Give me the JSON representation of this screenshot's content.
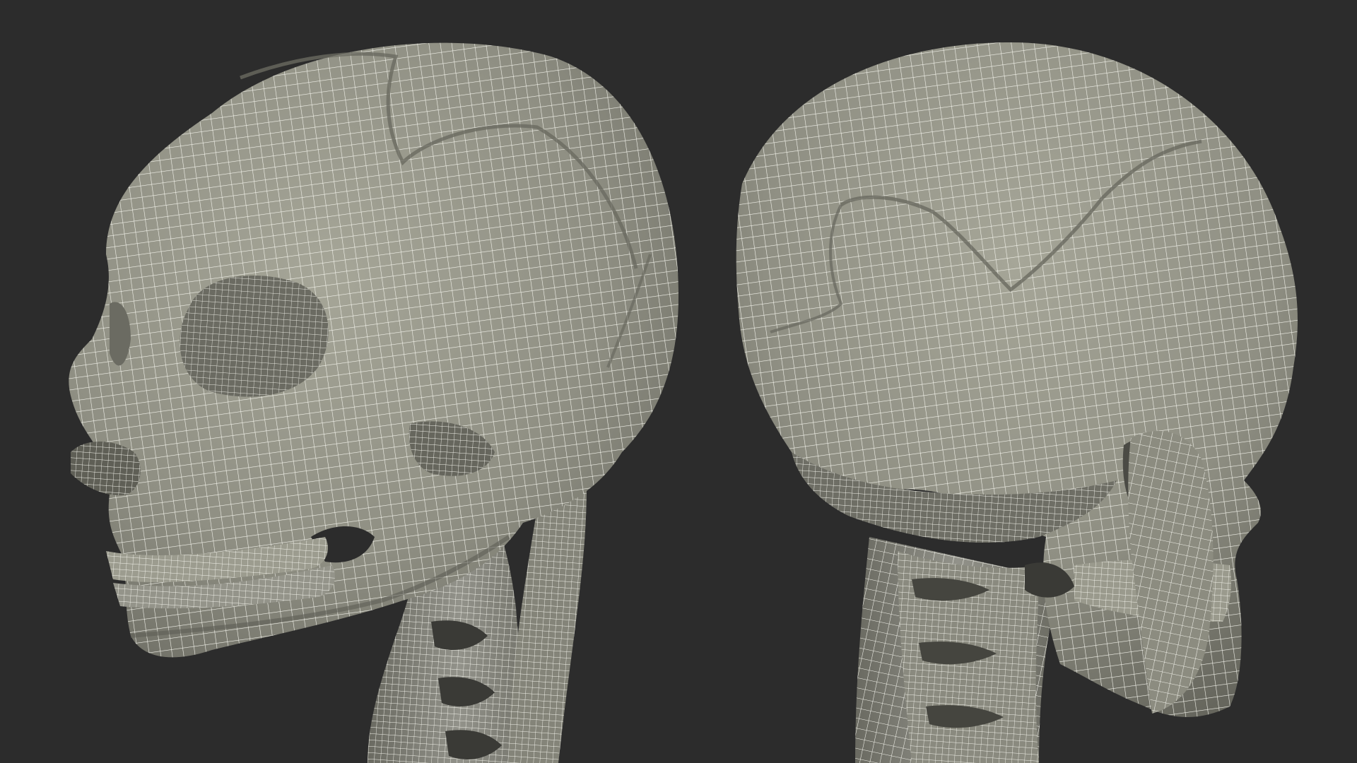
{
  "scene": {
    "background_color": "#2c2c2c",
    "mesh_fill_color": "#8f8f83",
    "mesh_shadow_color": "#5f5f56",
    "mesh_highlight_color": "#a9a99c",
    "wire_color": "#f4f4ec",
    "cavity_color": "#6c6c63"
  },
  "views": [
    {
      "view": "front-left"
    },
    {
      "view": "back-right"
    }
  ]
}
